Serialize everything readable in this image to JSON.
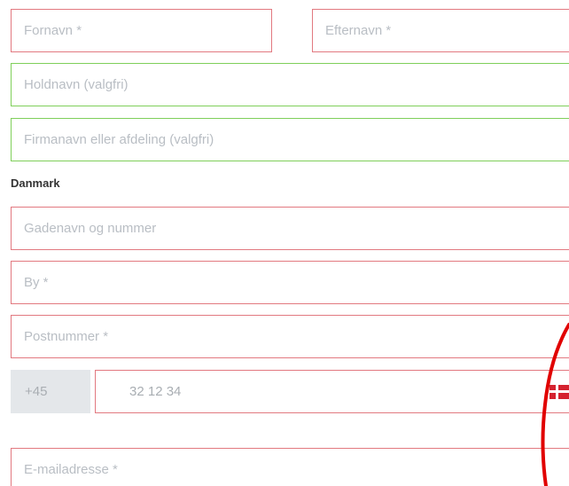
{
  "form": {
    "first_name": {
      "placeholder": "Fornavn *"
    },
    "last_name": {
      "placeholder": "Efternavn *"
    },
    "team_name": {
      "placeholder": "Holdnavn (valgfri)"
    },
    "company": {
      "placeholder": "Firmanavn eller afdeling (valgfri)"
    },
    "country_label": "Danmark",
    "street": {
      "placeholder": "Gadenavn og nummer"
    },
    "city": {
      "placeholder": "By *"
    },
    "postal_code": {
      "placeholder": "Postnummer *"
    },
    "phone": {
      "prefix": "+45",
      "value": "32 12 34",
      "flag": "denmark-flag-icon"
    },
    "email": {
      "placeholder": "E-mailadresse *"
    }
  },
  "colors": {
    "invalid_border": "#e27980",
    "valid_border": "#7fcf5a",
    "annotation_red": "#e10000",
    "prefix_bg": "#e4e7ea"
  }
}
